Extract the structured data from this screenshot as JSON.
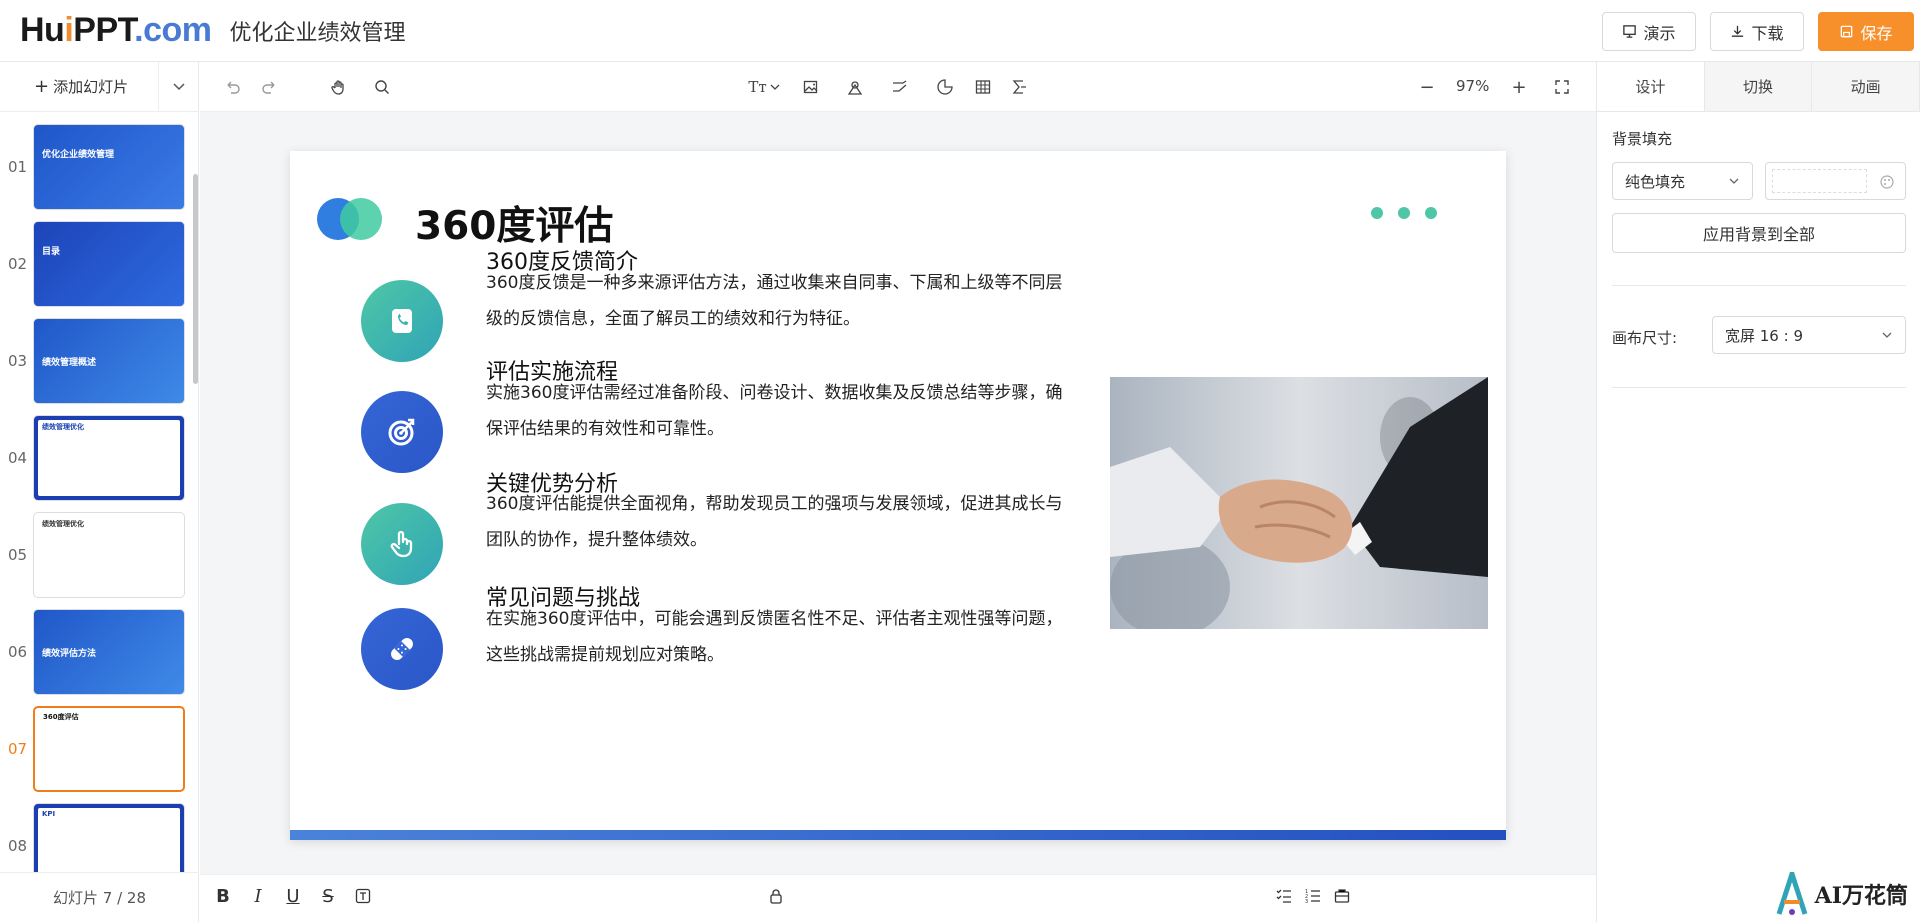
{
  "header": {
    "logo_hu": "Hu",
    "logo_i": "i",
    "logo_ppt": "PPT",
    "logo_com": ".com",
    "title": "优化企业绩效管理",
    "buttons": {
      "present": "演示",
      "download": "下载",
      "save": "保存"
    },
    "accent_color": "#f7902b"
  },
  "sidebar": {
    "add_label": "添加幻灯片",
    "slide_counter": "幻灯片 7 / 28",
    "thumbs": [
      {
        "num": "01",
        "title": "优化企业绩效管理"
      },
      {
        "num": "02",
        "title": "目录"
      },
      {
        "num": "03",
        "title": "绩效管理概述"
      },
      {
        "num": "04",
        "title": "绩效管理优化"
      },
      {
        "num": "05",
        "title": "绩效管理优化"
      },
      {
        "num": "06",
        "title": "绩效评估方法"
      },
      {
        "num": "07",
        "title": "360度评估"
      },
      {
        "num": "08",
        "title": "KPI"
      }
    ],
    "active_index": 6
  },
  "toolbar": {
    "zoom": "97%"
  },
  "slide": {
    "title": "360度评估",
    "items": [
      {
        "head": "360度反馈简介",
        "body": "360度反馈是一种多来源评估方法，通过收集来自同事、下属和上级等不同层级的反馈信息，全面了解员工的绩效和行为特征。"
      },
      {
        "head": "评估实施流程",
        "body": "实施360度评估需经过准备阶段、问卷设计、数据收集及反馈总结等步骤，确保评估结果的有效性和可靠性。"
      },
      {
        "head": "关键优势分析",
        "body": "360度评估能提供全面视角，帮助发现员工的强项与发展领域，促进其成长与团队的协作，提升整体绩效。"
      },
      {
        "head": "常见问题与挑战",
        "body": "在实施360度评估中，可能会遇到反馈匿名性不足、评估者主观性强等问题，这些挑战需提前规划应对策略。"
      }
    ]
  },
  "right_panel": {
    "tabs": [
      "设计",
      "切换",
      "动画"
    ],
    "bg_fill_label": "背景填充",
    "bg_fill_value": "纯色填充",
    "apply_all": "应用背景到全部",
    "canvas_size_label": "画布尺寸:",
    "canvas_size_value": "宽屏 16 : 9",
    "brand": "AI万花筒"
  }
}
